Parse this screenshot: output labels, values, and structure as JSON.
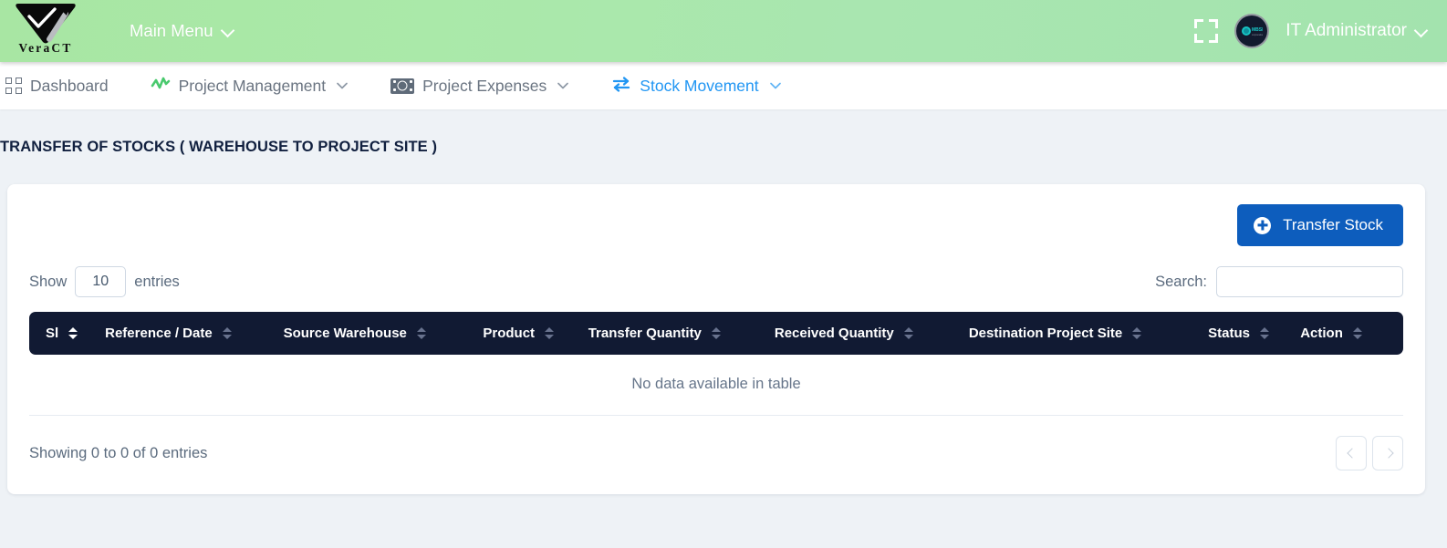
{
  "header": {
    "brand_name": "VeraCT",
    "brand_logo_icon": "veract-triangle-logo",
    "main_menu_label": "Main Menu",
    "main_menu_chevron_icon": "chevron-down-icon",
    "fullscreen_icon": "fullscreen-expand-icon",
    "avatar_icon": "user-avatar-mbsl-logo",
    "username": "IT Administrator",
    "user_chevron_icon": "chevron-down-icon",
    "gradient_start": "#a8e6a3",
    "gradient_end": "#a3e3ae"
  },
  "nav": {
    "items": [
      {
        "label": "Dashboard",
        "icon": "grid-dashboard-icon",
        "has_caret": false,
        "active": false
      },
      {
        "label": "Project Management",
        "icon": "activity-pulse-icon",
        "has_caret": true,
        "active": false
      },
      {
        "label": "Project Expenses",
        "icon": "banknote-money-icon",
        "has_caret": true,
        "active": false
      },
      {
        "label": "Stock Movement",
        "icon": "transfer-arrows-icon",
        "has_caret": true,
        "active": true
      }
    ],
    "active_color": "#2196f3",
    "inactive_color": "#6a7481"
  },
  "page": {
    "title": "TRANSFER OF STOCKS ( WAREHOUSE TO PROJECT SITE )",
    "background": "#eef2f6"
  },
  "toolbar": {
    "transfer_stock_label": "Transfer Stock",
    "transfer_stock_icon": "plus-circle-icon",
    "button_color": "#0d5dbd"
  },
  "controls": {
    "show_label": "Show",
    "entries_label": "entries",
    "page_length_value": "10",
    "search_label": "Search:",
    "search_value": "",
    "search_placeholder": ""
  },
  "table": {
    "header_background": "#111a33",
    "columns": [
      {
        "label": "Sl",
        "sortable": true,
        "sort_active": true
      },
      {
        "label": "Reference / Date",
        "sortable": true,
        "sort_active": false
      },
      {
        "label": "Source Warehouse",
        "sortable": true,
        "sort_active": false
      },
      {
        "label": "Product",
        "sortable": true,
        "sort_active": false
      },
      {
        "label": "Transfer Quantity",
        "sortable": true,
        "sort_active": false
      },
      {
        "label": "Received Quantity",
        "sortable": true,
        "sort_active": false
      },
      {
        "label": "Destination Project Site",
        "sortable": true,
        "sort_active": false
      },
      {
        "label": "Status",
        "sortable": true,
        "sort_active": false
      },
      {
        "label": "Action",
        "sortable": true,
        "sort_active": false
      }
    ],
    "rows": [],
    "empty_message": "No data available in table"
  },
  "footer": {
    "info": "Showing 0 to 0 of 0 entries",
    "prev_icon": "chevron-left-icon",
    "next_icon": "chevron-right-icon",
    "prev_label": "‹",
    "next_label": "›"
  }
}
